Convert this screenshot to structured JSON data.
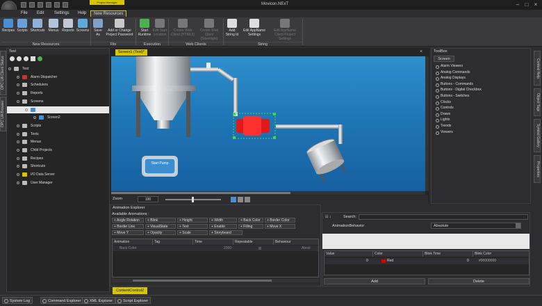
{
  "app": {
    "title": "Movicon.NExT",
    "context_tab": "Project Manager"
  },
  "menu": [
    "File",
    "Edit",
    "Settings",
    "Help",
    "New Resources"
  ],
  "ribbon": {
    "buttons": [
      {
        "label": "Recipes",
        "color": "#4a8fd1"
      },
      {
        "label": "Scripts",
        "color": "#6aa0d8"
      },
      {
        "label": "Shortcuts",
        "color": "#8fb0d8"
      },
      {
        "label": "Menus",
        "color": "#b0c4de"
      },
      {
        "label": "Reports",
        "color": "#c0c8d8"
      },
      {
        "label": "Screens",
        "color": "#5fa8e0"
      },
      {
        "label": "Save As",
        "color": "#7fa0c8"
      },
      {
        "label": "Add or Change Project Password",
        "color": "#c8c8c8"
      },
      {
        "label": "Start Runtime",
        "color": "#4caf50"
      },
      {
        "label": "Edit Start Location",
        "color": "#777777"
      },
      {
        "label": "Create Web Client (HTML5)",
        "color": "#777777"
      },
      {
        "label": "Create Web Client (Silverlight)",
        "color": "#777777"
      },
      {
        "label": "Add String Id",
        "color": "#dddddd"
      },
      {
        "label": "Edit AppName Settings",
        "color": "#dddddd"
      },
      {
        "label": "Edit AppName Client Project Settings",
        "color": "#777777"
      }
    ],
    "groups": [
      "New Resources",
      "File",
      "Execution",
      "Web Clients",
      "String"
    ]
  },
  "left_panel": {
    "title": "Test",
    "tabs": [
      "OPC UA Client Status",
      "OPC UA Browser"
    ],
    "tree": [
      {
        "label": "Test",
        "color": "#bbbbbb"
      },
      {
        "label": "Alarm Dispatcher",
        "color": "#cc3333"
      },
      {
        "label": "Schedulers",
        "color": "#bbbbbb"
      },
      {
        "label": "Reports",
        "color": "#bbbbbb"
      },
      {
        "label": "Screens",
        "color": "#bbbbbb"
      },
      {
        "label": "",
        "color": "#4a8fd1"
      },
      {
        "label": "Screen2",
        "color": "#4a8fd1"
      },
      {
        "label": "Scripts",
        "color": "#bbbbbb"
      },
      {
        "label": "Texts",
        "color": "#bbbbbb"
      },
      {
        "label": "Menus",
        "color": "#bbbbbb"
      },
      {
        "label": "Child Projects",
        "color": "#bbbbbb"
      },
      {
        "label": "Recipes",
        "color": "#bbbbbb"
      },
      {
        "label": "Shortcuts",
        "color": "#bbbbbb"
      },
      {
        "label": "I/O Data Server",
        "color": "#d9c400"
      },
      {
        "label": "User Manager",
        "color": "#bbbbbb"
      }
    ]
  },
  "document": {
    "tab": "Screen1 (Test)*",
    "button": "Start Pump",
    "zoom_label": "Zoom",
    "zoom_value": "100"
  },
  "toolbox": {
    "title": "ToolBox",
    "section": "Screen",
    "items": [
      "Alarm Viewers",
      "Analog Commands",
      "Analog Displays",
      "Buttons - Commands",
      "Buttons - Digital Checkbox",
      "Buttons - Switches",
      "Clocks",
      "Controls",
      "Draws",
      "Lights",
      "Trends",
      "Viewers"
    ]
  },
  "right_tabs": [
    "Context Help",
    "Object Tags",
    "Symbol Gallery",
    "Properties"
  ],
  "animation_explorer": {
    "title": "Animation Explorer",
    "available": "Available Animations :",
    "chips": [
      "+ Angle Rotation",
      "+ Blink",
      "+ Height",
      "+ Width",
      "+ Back Color",
      "+ Border Color",
      "+ Border Line",
      "+ VisualState",
      "+ Text",
      "+ Enable",
      "+ Filling",
      "+ Move X",
      "+ Move Y",
      "+ Opacity",
      "+ Scale",
      "+ Storyboard"
    ],
    "columns": [
      "Animation",
      "Tag",
      "Time",
      "Repeatable",
      "Behaviour"
    ],
    "row": {
      "animation": "Back Color",
      "time": "2000",
      "behaviour": "Absol"
    }
  },
  "properties": {
    "search_label": "Search:",
    "behavior_label": "AnimationBehavior",
    "behavior_value": "Absolute",
    "columns": [
      "Value",
      "Color",
      "Blink Time",
      "Blink Color"
    ],
    "row": {
      "value": "0",
      "color_name": "Red",
      "color": "#e00000",
      "blink_time": "0",
      "blink_color": "#00000000"
    },
    "add": "Add",
    "delete": "Delete"
  },
  "content_tab": "ContentControl2",
  "status_tabs": [
    "System Log",
    "Command Explorer",
    "XML Explorer",
    "Script Explorer"
  ]
}
